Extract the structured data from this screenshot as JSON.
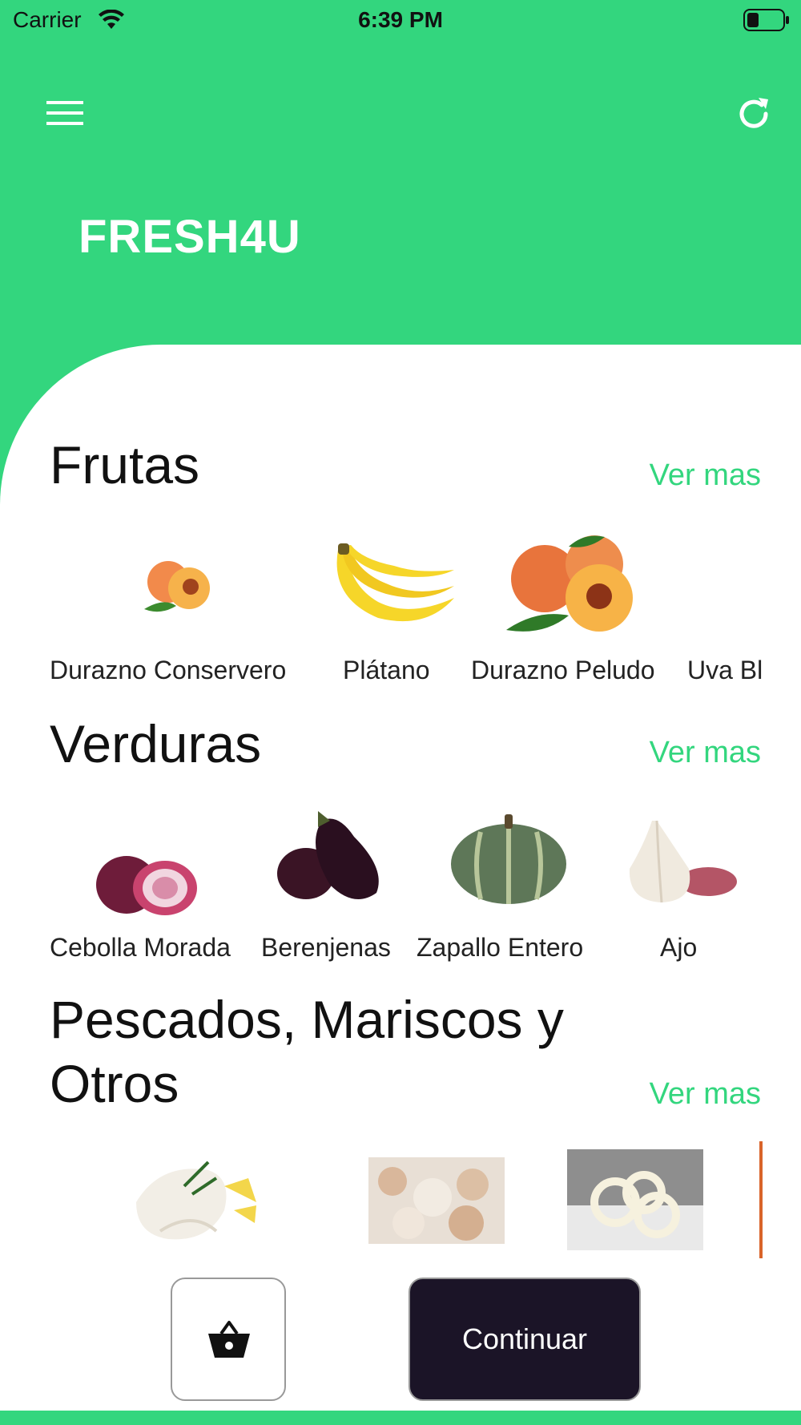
{
  "status_bar": {
    "carrier": "Carrier",
    "time": "6:39 PM"
  },
  "header": {
    "title": "FRESH4U",
    "menu_icon": "hamburger-icon",
    "refresh_icon": "refresh-icon"
  },
  "sections": [
    {
      "title": "Frutas",
      "more_label": "Ver mas",
      "items": [
        {
          "label": "Durazno Conservero",
          "icon": "peach-image"
        },
        {
          "label": "Plátano",
          "icon": "banana-image"
        },
        {
          "label": "Durazno Peludo",
          "icon": "peach-group-image"
        },
        {
          "label": "Uva Bl",
          "icon": "grape-image"
        }
      ]
    },
    {
      "title": "Verduras",
      "more_label": "Ver mas",
      "items": [
        {
          "label": "Cebolla Morada",
          "icon": "red-onion-image"
        },
        {
          "label": "Berenjenas",
          "icon": "eggplant-image"
        },
        {
          "label": "Zapallo Entero",
          "icon": "pumpkin-image"
        },
        {
          "label": "Ajo",
          "icon": "garlic-image"
        }
      ]
    },
    {
      "title_line1": "Pescados, Mariscos y",
      "title_line2": "Otros",
      "more_label": "Ver mas",
      "items": [
        {
          "icon": "fish-fillet-image"
        },
        {
          "icon": "crab-meat-image"
        },
        {
          "icon": "squid-rings-image"
        }
      ]
    }
  ],
  "footer": {
    "basket_icon": "basket-icon",
    "continue_label": "Continuar"
  },
  "colors": {
    "brand_green": "#33D67E",
    "dark_button": "#1B1427",
    "white": "#FFFFFF"
  }
}
